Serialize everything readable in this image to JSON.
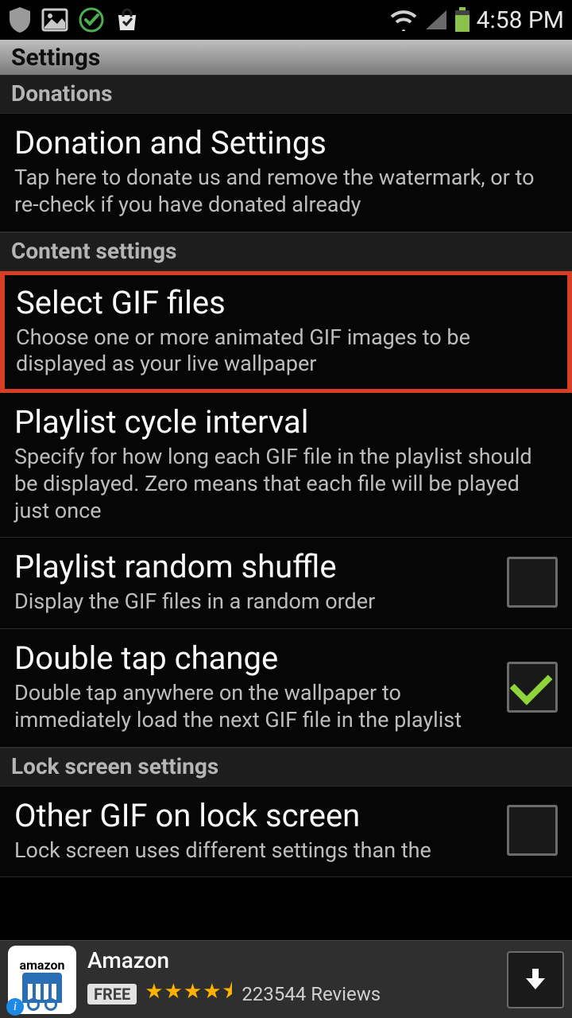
{
  "status": {
    "time": "4:58 PM"
  },
  "app_title": "Settings",
  "sections": {
    "donations": {
      "header": "Donations",
      "item": {
        "title": "Donation and Settings",
        "desc": "Tap here to donate us and remove the watermark, or to re-check if you have donated already"
      }
    },
    "content_settings": {
      "header": "Content settings",
      "select_gif": {
        "title": "Select GIF files",
        "desc": "Choose one or more animated GIF images to be displayed as your live wallpaper"
      },
      "cycle_interval": {
        "title": "Playlist cycle interval",
        "desc": "Specify for how long each GIF file in the playlist should be displayed. Zero means that each file will be played just once"
      },
      "random_shuffle": {
        "title": "Playlist random shuffle",
        "desc": "Display the GIF files in a random order",
        "checked": false
      },
      "double_tap": {
        "title": "Double tap change",
        "desc": "Double tap anywhere on the wallpaper to immediately load the next GIF file in the playlist",
        "checked": true
      }
    },
    "lock_screen": {
      "header": "Lock screen settings",
      "other_gif": {
        "title": "Other GIF on lock screen",
        "desc": "Lock screen uses different settings than the",
        "checked": false
      }
    }
  },
  "ad": {
    "title": "Amazon",
    "price": "FREE",
    "stars": "★★★★⯨",
    "reviews": "223544 Reviews"
  }
}
